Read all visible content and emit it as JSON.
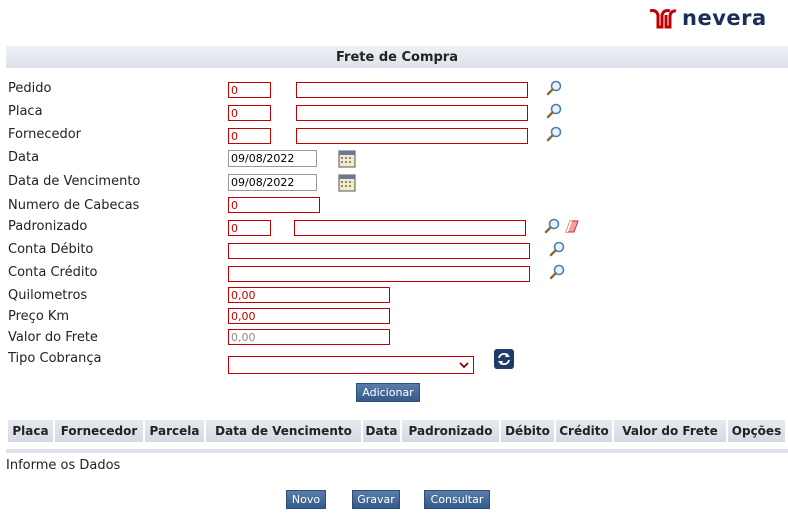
{
  "brand": {
    "name": "nevera",
    "color": "#1a2e5a",
    "accent": "#c00000"
  },
  "title": "Frete de Compra",
  "fields": {
    "pedido": {
      "label": "Pedido",
      "code": "0",
      "desc": ""
    },
    "placa": {
      "label": "Placa",
      "code": "0",
      "desc": ""
    },
    "fornecedor": {
      "label": "Fornecedor",
      "code": "0",
      "desc": ""
    },
    "data": {
      "label": "Data",
      "value": "09/08/2022"
    },
    "data_vencimento": {
      "label": "Data de Vencimento",
      "value": "09/08/2022"
    },
    "numero_cabecas": {
      "label": "Numero de Cabecas",
      "value": "0"
    },
    "padronizado": {
      "label": "Padronizado",
      "code": "0",
      "desc": ""
    },
    "conta_debito": {
      "label": "Conta Débito",
      "value": ""
    },
    "conta_credito": {
      "label": "Conta Crédito",
      "value": ""
    },
    "quilometros": {
      "label": "Quilometros",
      "value": "0,00"
    },
    "preco_km": {
      "label": "Preço Km",
      "value": "0,00"
    },
    "valor_frete": {
      "label": "Valor do Frete",
      "value": "0,00"
    },
    "tipo_cobranca": {
      "label": "Tipo Cobrança",
      "value": ""
    }
  },
  "buttons": {
    "adicionar": "Adicionar",
    "novo": "Novo",
    "gravar": "Gravar",
    "consultar": "Consultar"
  },
  "table": {
    "columns": [
      "Placa",
      "Fornecedor",
      "Parcela",
      "Data de Vencimento",
      "Data",
      "Padronizado",
      "Débito",
      "Crédito",
      "Valor do Frete",
      "Opções"
    ]
  },
  "status": "Informe os Dados",
  "icons": {
    "lookup": "magnifier-icon",
    "calendar": "calendar-icon",
    "clear": "eraser-icon",
    "refresh": "refresh-icon"
  }
}
